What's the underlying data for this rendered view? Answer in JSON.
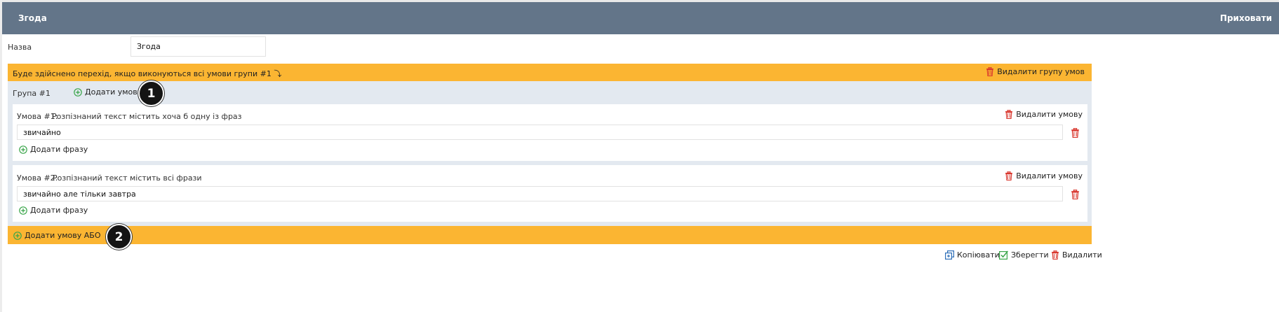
{
  "header": {
    "title": "Згода",
    "hide_label": "Приховати"
  },
  "name_field": {
    "label": "Назва",
    "value": "Згода"
  },
  "group_banner": {
    "text": "Буде здійснено перехід, якщо виконуються всі умови групи #1 ⤵",
    "delete_label": "Видалити групу умов"
  },
  "group": {
    "label": "Група #1",
    "add_and_label": "Додати умову \"і\""
  },
  "conditions": [
    {
      "label": "Умова #1:",
      "description": "Розпізнаний текст містить хоча б одну із фраз",
      "delete_label": "Видалити умову",
      "phrase": "звичайно",
      "add_phrase_label": "Додати фразу"
    },
    {
      "label": "Умова #2:",
      "description": "Розпізнаний текст містить всі фрази",
      "delete_label": "Видалити умову",
      "phrase": "звичайно але тільки завтра",
      "add_phrase_label": "Додати фразу"
    }
  ],
  "add_or": {
    "label": "Додати умову АБО"
  },
  "badges": [
    "1",
    "2"
  ],
  "footer": {
    "copy_label": "Копіювати",
    "save_label": "Зберегти",
    "delete_label": "Видалити"
  },
  "colors": {
    "header": "#637589",
    "orange": "#fbb532",
    "group_bg": "#e3e9f0",
    "green_icon": "#3aa64a",
    "red_icon": "#d9372e",
    "blue_icon": "#2f6fb8"
  }
}
